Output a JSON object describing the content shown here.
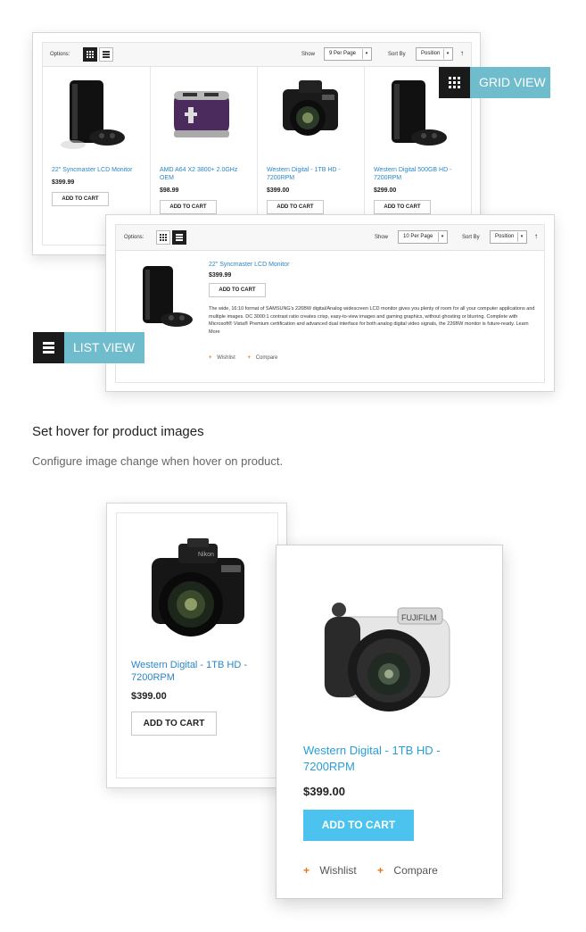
{
  "grid_panel": {
    "options_label": "Options:",
    "show_label": "Show",
    "per_page": "9 Per Page",
    "sort_label": "Sort By",
    "sort_value": "Position",
    "products": [
      {
        "name": "22\" Syncmaster LCD Monitor",
        "price": "$399.99",
        "button": "ADD TO CART",
        "icon": "console-image"
      },
      {
        "name": "AMD A64 X2 3800+ 2.0GHz OEM",
        "price": "$98.99",
        "button": "ADD TO CART",
        "icon": "toaster-image"
      },
      {
        "name": "Western Digital - 1TB HD - 7200RPM",
        "price": "$399.00",
        "button": "ADD TO CART",
        "icon": "camera-image"
      },
      {
        "name": "Western Digital 500GB HD - 7200RPM",
        "price": "$299.00",
        "button": "ADD TO CART",
        "icon": "console-image"
      }
    ]
  },
  "grid_view_label": "GRID VIEW",
  "list_panel": {
    "options_label": "Options:",
    "show_label": "Show",
    "per_page": "10 Per Page",
    "sort_label": "Sort By",
    "sort_value": "Position",
    "product": {
      "name": "22\" Syncmaster LCD Monitor",
      "price": "$399.99",
      "button": "ADD TO CART",
      "description": "The wide, 16:10 format of SAMSUNG's 226BW digital/Analog widescreen LCD monitor gives you plenty of room for all your computer applications and multiple images. DC 3000:1 contrast ratio creates crisp, easy-to-view images and gaming graphics, without ghosting or blurring. Complete with Microsoft® Vista® Premium certification and advanced dual interface for both analog digital video signals, the 226BW monitor is future-ready.",
      "learn_more": "Learn More",
      "wishlist": "Wishlist",
      "compare": "Compare"
    }
  },
  "list_view_label": "LIST VIEW",
  "hover_section": {
    "heading": "Set hover for product images",
    "subheading": "Configure image change when hover on product."
  },
  "hover_card_back": {
    "name": "Western Digital - 1TB HD - 7200RPM",
    "price": "$399.00",
    "button": "ADD TO CART"
  },
  "hover_card_front": {
    "name": "Western Digital - 1TB HD - 7200RPM",
    "price": "$399.00",
    "button": "ADD TO CART",
    "wishlist": "Wishlist",
    "compare": "Compare"
  },
  "colors": {
    "accent_blue": "#4cc3ee",
    "banner_teal": "#6fbccc",
    "link_blue": "#2a86c6",
    "plus_orange": "#e07a1a"
  }
}
